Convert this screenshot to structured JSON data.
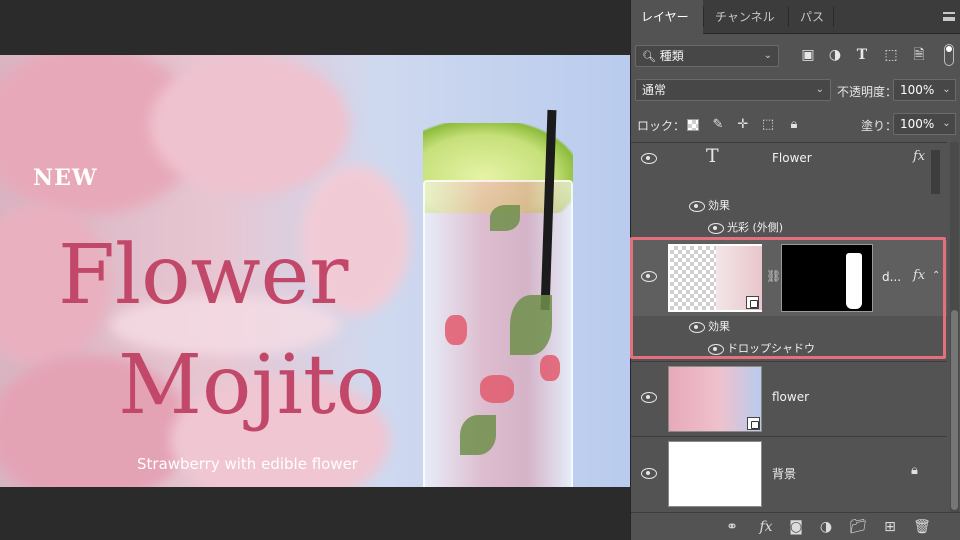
{
  "artwork": {
    "badge": "NEW",
    "title_line1": "Flower",
    "title_line2": "Mojito",
    "subtitle": "Strawberry with edible flower"
  },
  "panel": {
    "tabs": [
      {
        "label": "レイヤー",
        "active": true
      },
      {
        "label": "チャンネル",
        "active": false
      },
      {
        "label": "パス",
        "active": false
      }
    ],
    "filter": {
      "kind": "種類"
    },
    "filter_icons": [
      "image-filter-icon",
      "adjustment-filter-icon",
      "type-filter-icon",
      "shape-filter-icon",
      "smart-object-filter-icon"
    ],
    "blend_mode": "通常",
    "opacity_label": "不透明度：",
    "opacity_value": "100%",
    "lock_label": "ロック：",
    "fill_label": "塗り：",
    "fill_value": "100%"
  },
  "layers": [
    {
      "name": "Flower",
      "type": "text",
      "fx": "fx",
      "effects_label": "効果",
      "effects": [
        "光彩 (外側)"
      ]
    },
    {
      "name": "d...",
      "type": "smart-object-masked",
      "fx": "fx",
      "effects_label": "効果",
      "effects": [
        "ドロップシャドウ"
      ]
    },
    {
      "name": "flower",
      "type": "smart-object"
    },
    {
      "name": "背景",
      "type": "background"
    }
  ],
  "colors": {
    "panel_bg": "#535353",
    "accent_highlight": "#e3707c",
    "title_pink": "#c2486a"
  }
}
